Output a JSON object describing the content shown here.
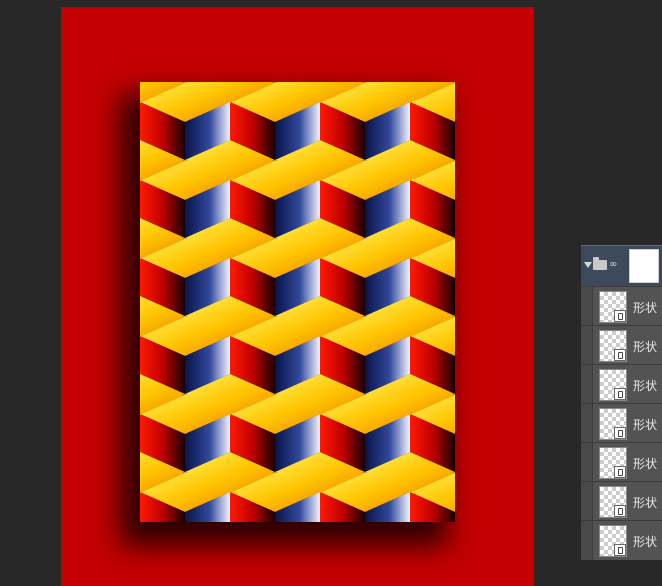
{
  "workspace": {
    "canvas_color": "#c40000",
    "background_color": "#282828"
  },
  "artwork": {
    "description_icon": "isometric-cube-pattern",
    "colors": {
      "top_light": "#fff25a",
      "top_dark": "#f7a300",
      "left_dark": "#c40000",
      "right_dark": "#0c1a5c",
      "right_light": "#eef0ff"
    }
  },
  "layers_panel": {
    "group": {
      "expanded_icon": "triangle-down-icon",
      "folder_icon": "folder-icon",
      "link_icon": "chain-link-icon"
    },
    "layers": [
      {
        "name": "形状"
      },
      {
        "name": "形状"
      },
      {
        "name": "形状"
      },
      {
        "name": "形状"
      },
      {
        "name": "形状"
      },
      {
        "name": "形状"
      },
      {
        "name": "形状"
      }
    ]
  }
}
